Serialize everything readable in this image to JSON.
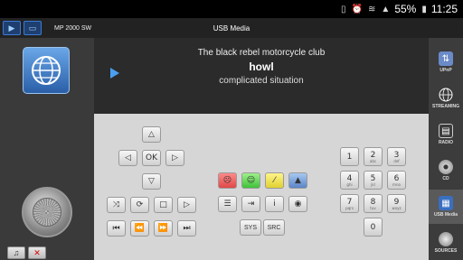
{
  "status_bar": {
    "battery": "55%",
    "time": "11:25"
  },
  "header": {
    "device_name": "MP 2000 SW",
    "title": "USB Media"
  },
  "now_playing": {
    "artist": "The black rebel motorcycle club",
    "title": "howl",
    "album": "complicated situation"
  },
  "nav": {
    "ok_label": "OK"
  },
  "function_buttons": {
    "info_label": "i",
    "sys_label": "SYS",
    "src_label": "SRC"
  },
  "keypad": [
    {
      "digit": "1",
      "letters": ""
    },
    {
      "digit": "2",
      "letters": "abc"
    },
    {
      "digit": "3",
      "letters": "def"
    },
    {
      "digit": "4",
      "letters": "ghi"
    },
    {
      "digit": "5",
      "letters": "jkl"
    },
    {
      "digit": "6",
      "letters": "mno"
    },
    {
      "digit": "7",
      "letters": "pqrs"
    },
    {
      "digit": "8",
      "letters": "tuv"
    },
    {
      "digit": "9",
      "letters": "wxyz"
    },
    {
      "digit": "0",
      "letters": ""
    }
  ],
  "sidebar": {
    "items": [
      {
        "label": "UPnP",
        "icon": "upnp-icon"
      },
      {
        "label": "STREAMING",
        "icon": "globe-icon"
      },
      {
        "label": "RADIO",
        "icon": "radio-icon"
      },
      {
        "label": "CD",
        "icon": "cd-icon"
      },
      {
        "label": "USB Media",
        "icon": "usb-icon",
        "active": true
      },
      {
        "label": "SOURCES",
        "icon": "sources-icon"
      }
    ]
  },
  "colors": {
    "accent": "#4a9ff0",
    "panel": "#d6d6d6",
    "dark": "#2b2b2b"
  }
}
